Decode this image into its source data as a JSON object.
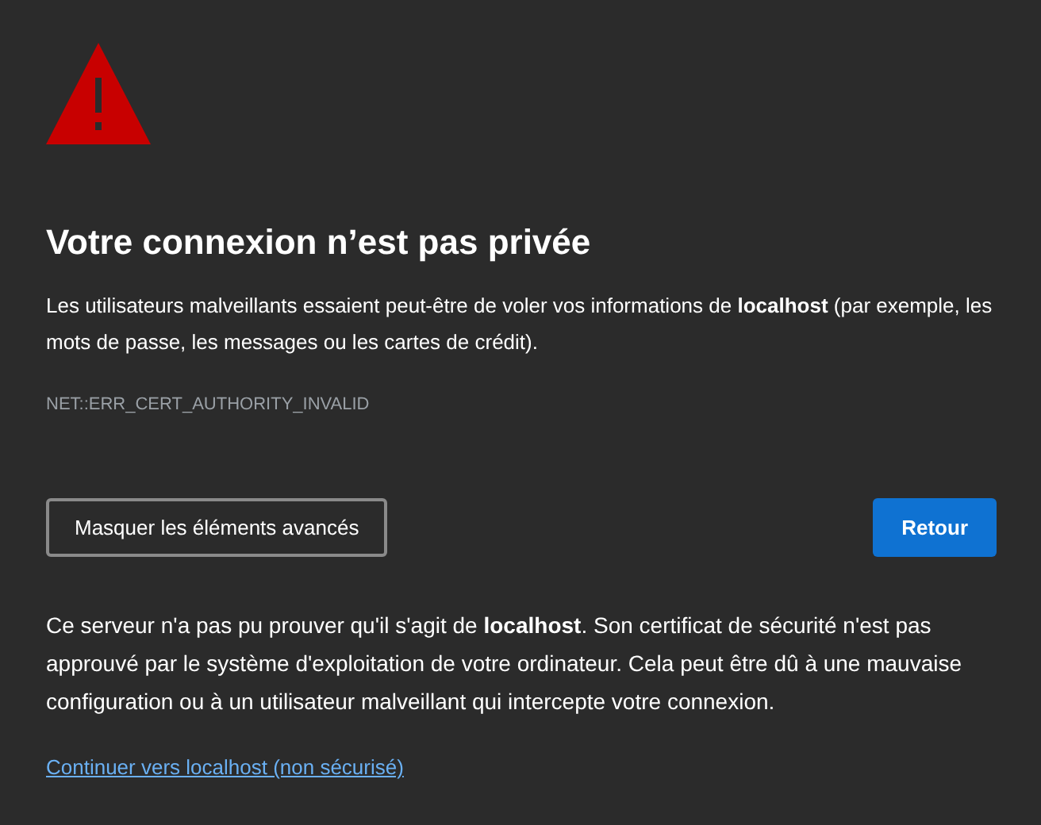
{
  "heading": "Votre connexion n’est pas privée",
  "summary": "Les utilisateurs malveillants essaient peut-être de voler vos informations de **localhost** (par exemple, les mots de passe, les messages ou les cartes de crédit).",
  "error_code": "NET::ERR_CERT_AUTHORITY_INVALID",
  "buttons": [
    {
      "label": "Masquer les éléments avancés",
      "kind": "secondary"
    },
    {
      "label": "Retour",
      "kind": "primary"
    }
  ],
  "details": "Ce serveur n'a pas pu prouver qu'il s'agit de **localhost**. Son certificat de sécurité n'est pas approuvé par le système d'exploitation de votre ordinateur. Cela peut être dû à une mauvaise configuration ou à un utilisateur malveillant qui intercepte votre connexion.",
  "proceed_link": "Continuer vers localhost (non sécurisé)"
}
